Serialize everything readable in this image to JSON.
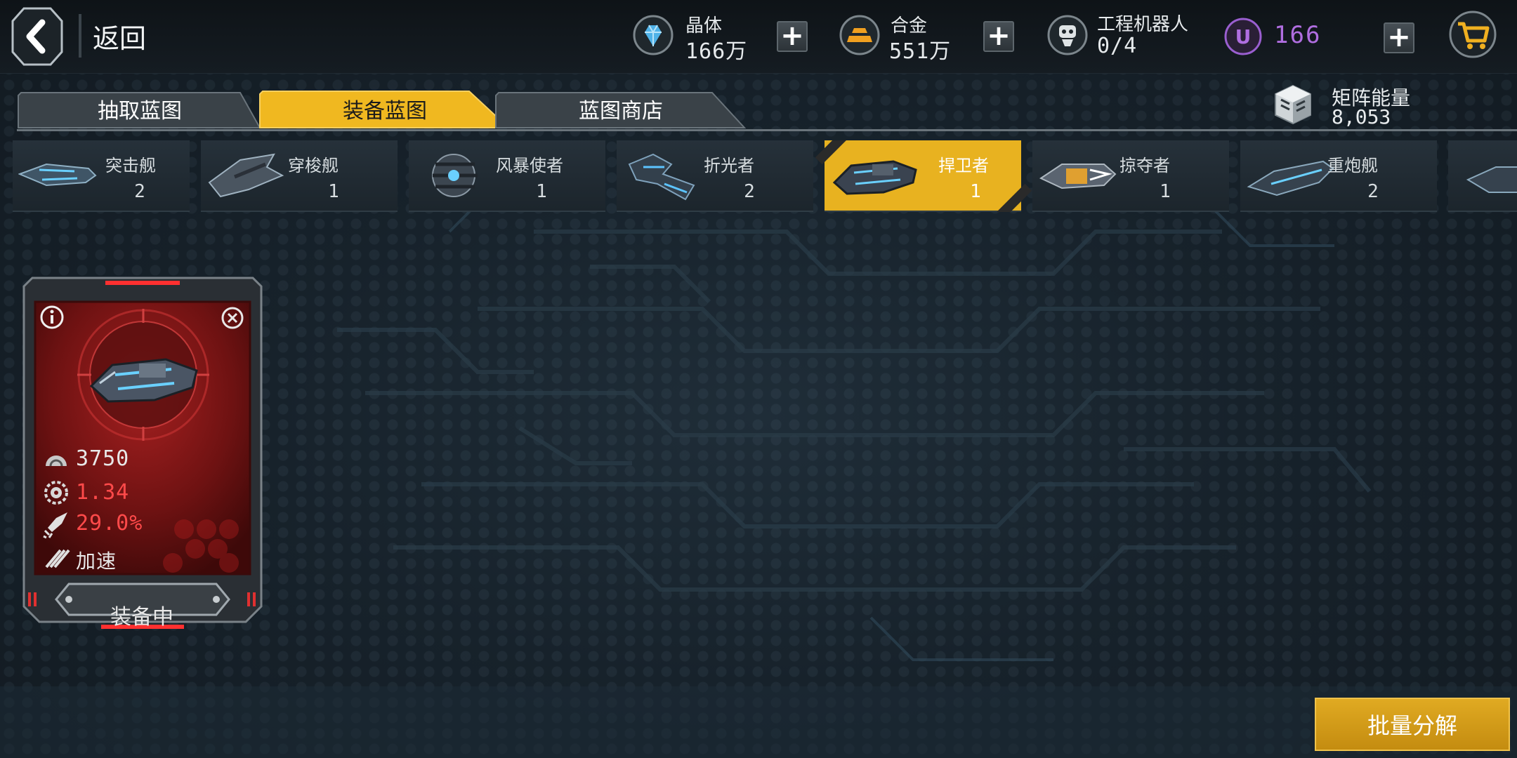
{
  "header": {
    "back_label": "返回",
    "resources": [
      {
        "name": "晶体",
        "value": "166万",
        "icon": "crystal-icon"
      },
      {
        "name": "合金",
        "value": "551万",
        "icon": "alloy-icon"
      },
      {
        "name": "工程机器人",
        "value": "0/4",
        "icon": "robot-icon"
      }
    ],
    "u_currency": {
      "symbol": "U",
      "value": "166",
      "icon": "u-coin-icon"
    },
    "cart_icon": "cart-icon"
  },
  "tabs": [
    {
      "label": "抽取蓝图",
      "active": false
    },
    {
      "label": "装备蓝图",
      "active": true
    },
    {
      "label": "蓝图商店",
      "active": false
    }
  ],
  "matrix_energy": {
    "label": "矩阵能量",
    "value": "8,053",
    "icon": "matrix-cube-icon"
  },
  "ship_classes": [
    {
      "name": "突击舰",
      "count": "2",
      "active": false
    },
    {
      "name": "穿梭舰",
      "count": "1",
      "active": false
    },
    {
      "name": "风暴使者",
      "count": "1",
      "active": false
    },
    {
      "name": "折光者",
      "count": "2",
      "active": false
    },
    {
      "name": "捍卫者",
      "count": "1",
      "active": true
    },
    {
      "name": "掠夺者",
      "count": "1",
      "active": false
    },
    {
      "name": "重炮舰",
      "count": "2",
      "active": false
    }
  ],
  "blueprint_card": {
    "stats": [
      {
        "icon": "armor-icon",
        "value": "3750",
        "color": "#e8e8e8"
      },
      {
        "icon": "gear-icon",
        "value": "1.34",
        "color": "#ff4a4a"
      },
      {
        "icon": "rocket-icon",
        "value": "29.0%",
        "color": "#ff4a4a"
      },
      {
        "icon": "speed-icon",
        "value": "加速",
        "color": "#e8e8e8"
      }
    ],
    "status": "装备中"
  },
  "actions": {
    "decompose_label": "批量分解"
  },
  "colors": {
    "accent": "#e8b220",
    "card_red": "#8a1a1a",
    "u_purple": "#b06ee0"
  }
}
